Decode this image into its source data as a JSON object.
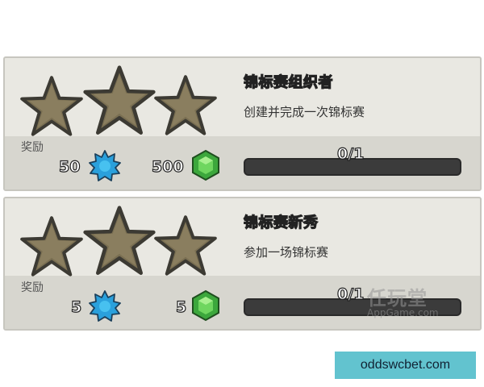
{
  "reward_label": "奖励",
  "achievements": [
    {
      "title": "锦标赛组织者",
      "description": "创建并完成一次锦标赛",
      "reward_blue": "50",
      "reward_gems": "500",
      "progress_text": "0/1",
      "progress_fraction": 0,
      "stars_earned": 0,
      "stars_total": 3
    },
    {
      "title": "锦标赛新秀",
      "description": "参加一场锦标赛",
      "reward_blue": "5",
      "reward_gems": "5",
      "progress_text": "0/1",
      "progress_fraction": 0,
      "stars_earned": 0,
      "stars_total": 3
    }
  ],
  "watermark": {
    "main": "任玩堂",
    "sub": "AppGame.com"
  },
  "footer_link": "oddswcbet.com",
  "colors": {
    "star": "#7a6f52",
    "bar": "#3b3b3b",
    "panel": "#e9e8e2",
    "footer": "#62c3cf",
    "gem": "#3ca73c",
    "blue_badge": "#2aa0dc"
  }
}
